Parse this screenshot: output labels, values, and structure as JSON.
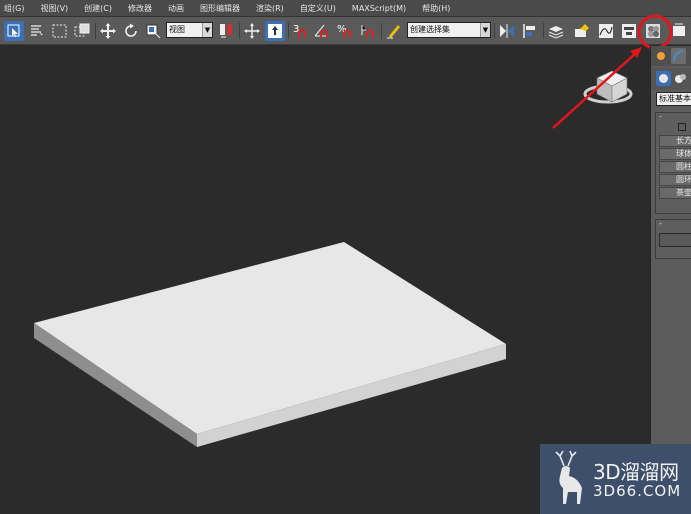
{
  "menubar": {
    "items": [
      "组(G)",
      "视图(V)",
      "创建(C)",
      "修改器",
      "动画",
      "图形编辑器",
      "渲染(R)",
      "自定义(U)",
      "MAXScript(M)",
      "帮助(H)"
    ]
  },
  "toolbar": {
    "view_dropdown": "视图",
    "selection_set_dropdown": "创建选择集",
    "snap_label": "3",
    "icons": [
      "select-object-icon",
      "select-by-name-icon",
      "rectangular-selection-icon",
      "window-crossing-icon",
      "move-icon",
      "rotate-icon",
      "scale-icon",
      "pivot-icon",
      "manipulate-icon",
      "snaps-toggle-icon",
      "angle-snap-icon",
      "percent-snap-icon",
      "spinner-snap-icon",
      "edit-named-selection-icon",
      "mirror-icon",
      "align-icon",
      "layer-manager-icon",
      "curve-editor-icon",
      "schematic-view-icon",
      "material-editor-icon",
      "render-setup-icon"
    ],
    "highlight_color": "#e0161d"
  },
  "command_panel": {
    "category_dropdown": "标准基本",
    "object_type_buttons": [
      "长方体",
      "球体",
      "圆柱体",
      "圆环",
      "茶壶"
    ],
    "rollout_minus": "-"
  },
  "watermark": {
    "line1": "3D溜溜网",
    "line2": "3D66.COM"
  },
  "colors": {
    "viewport_bg": "#2b2b2b",
    "toolbar_bg": "#5a5a5a",
    "active_button": "#3b6fb6",
    "box_top": "#e8e8e8",
    "annotation_red": "#e0161d"
  }
}
